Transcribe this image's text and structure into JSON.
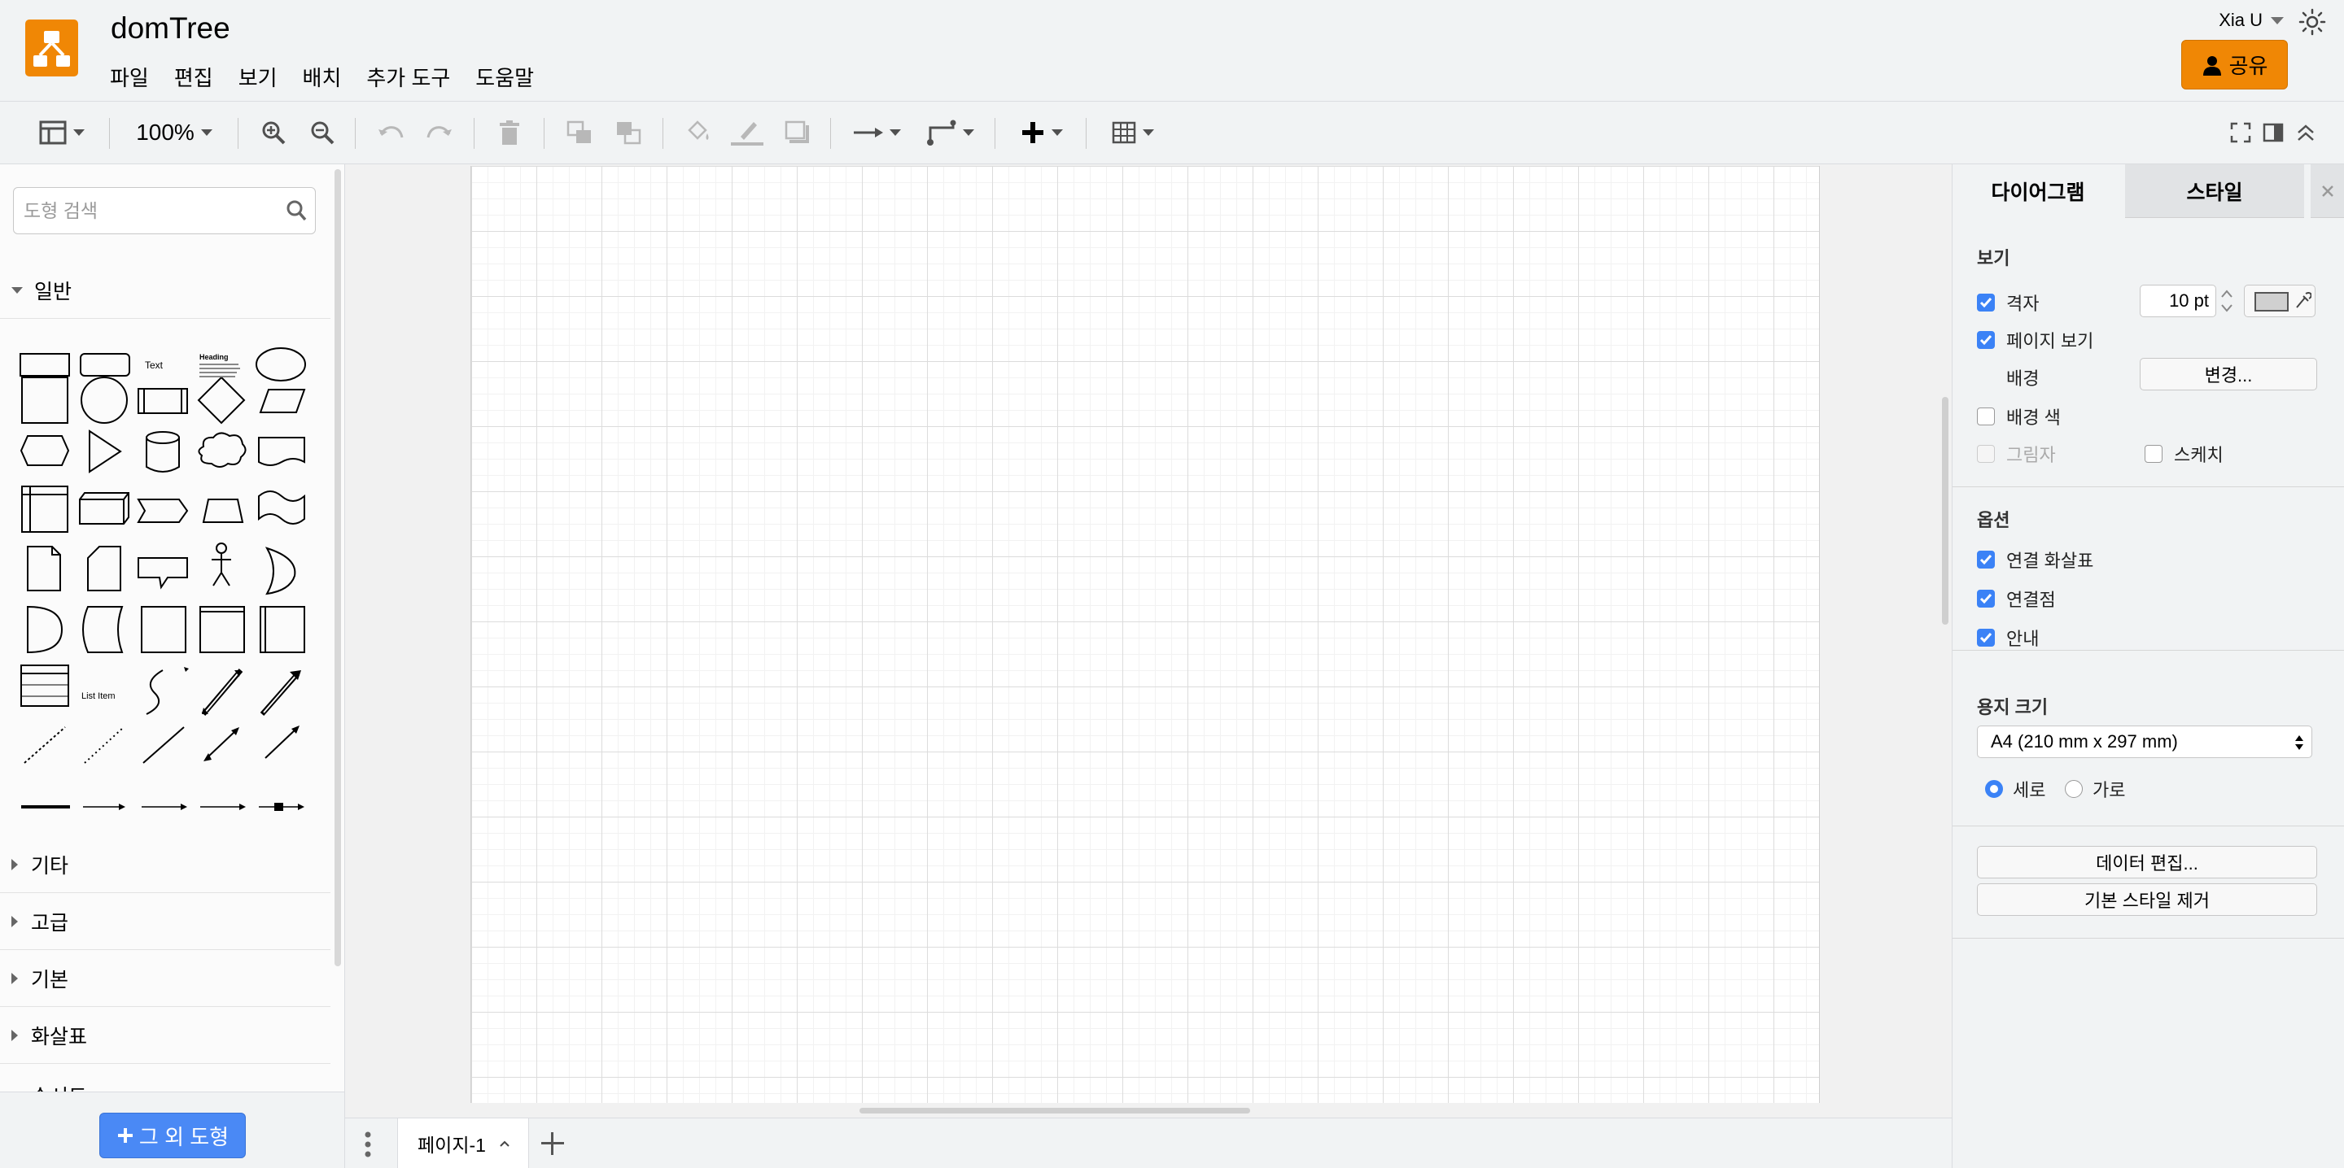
{
  "app": {
    "title": "domTree",
    "menu": [
      "파일",
      "편집",
      "보기",
      "배치",
      "추가 도구",
      "도움말"
    ],
    "user": "Xia U",
    "share_label": "공유",
    "brand_color": "#f08705"
  },
  "toolbar": {
    "zoom": "100%",
    "icons": [
      "format-panel-icon",
      "zoom-in-icon",
      "zoom-out-icon",
      "undo-icon",
      "redo-icon",
      "delete-icon",
      "to-front-icon",
      "to-back-icon",
      "fill-color-icon",
      "line-color-icon",
      "shadow-icon",
      "connection-icon",
      "waypoints-icon",
      "insert-icon",
      "table-icon",
      "fullscreen-icon",
      "toggle-panel-icon",
      "collapse-icon"
    ]
  },
  "sidebar": {
    "search_placeholder": "도형 검색",
    "open_section": "일반",
    "palette_text_shape": "Text",
    "palette_heading_shape": "Heading",
    "palette_list_item": "List Item",
    "sections": [
      "기타",
      "고급",
      "기본",
      "화살표",
      "순서도"
    ],
    "more_shapes_label": "그 외 도형"
  },
  "pages": {
    "current": "페이지-1"
  },
  "format_panel": {
    "tabs": [
      "다이어그램",
      "스타일"
    ],
    "view": {
      "title": "보기",
      "grid_label": "격자",
      "grid_checked": true,
      "grid_size": "10 pt",
      "page_view_label": "페이지 보기",
      "page_view_checked": true,
      "background_label": "배경",
      "change_button": "변경...",
      "background_color_label": "배경 색",
      "shadow_label": "그림자",
      "sketch_label": "스케치"
    },
    "options": {
      "title": "옵션",
      "connection_arrows": "연결 화살표",
      "connection_points": "연결점",
      "guides": "안내"
    },
    "paper": {
      "title": "용지 크기",
      "selected": "A4 (210 mm x 297 mm)",
      "portrait": "세로",
      "landscape": "가로",
      "orientation": "portrait"
    },
    "buttons": {
      "edit_data": "데이터 편집...",
      "clear_default_style": "기본 스타일 제거"
    }
  }
}
